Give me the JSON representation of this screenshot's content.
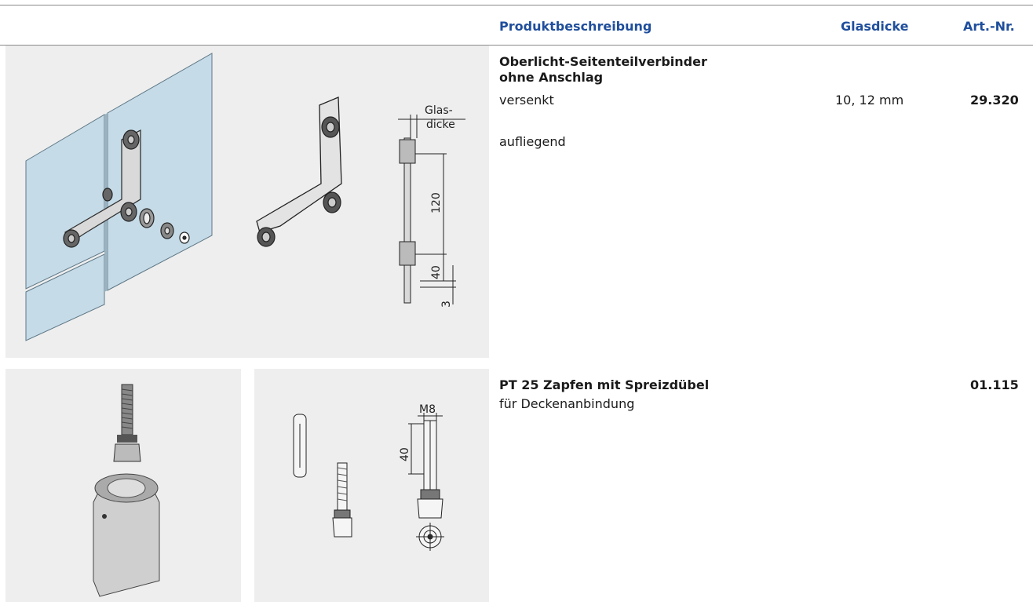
{
  "header": {
    "col_description": "Produktbeschreibung",
    "col_glass": "Glasdicke",
    "col_artnr": "Art.-Nr."
  },
  "products": [
    {
      "title_line1": "Oberlicht-Seitenteilverbinder",
      "title_line2": "ohne Anschlag",
      "variants": [
        "versenkt",
        "aufliegend"
      ],
      "glass_thickness": "10, 12 mm",
      "article_number": "29.320",
      "drawing_labels": {
        "glas1": "Glas-",
        "glas2": "dicke",
        "dim_120": "120",
        "dim_40": "40",
        "dim_3": "3"
      }
    },
    {
      "title": "PT 25 Zapfen mit Spreizdübel",
      "subtitle": "für Deckenanbindung",
      "article_number": "01.115",
      "drawing_labels": {
        "m8": "M8",
        "dim_40": "40"
      }
    }
  ],
  "colors": {
    "header_blue": "#1f4e9c",
    "glass": "#c5dbe8",
    "panel_bg": "#eeeeee"
  }
}
